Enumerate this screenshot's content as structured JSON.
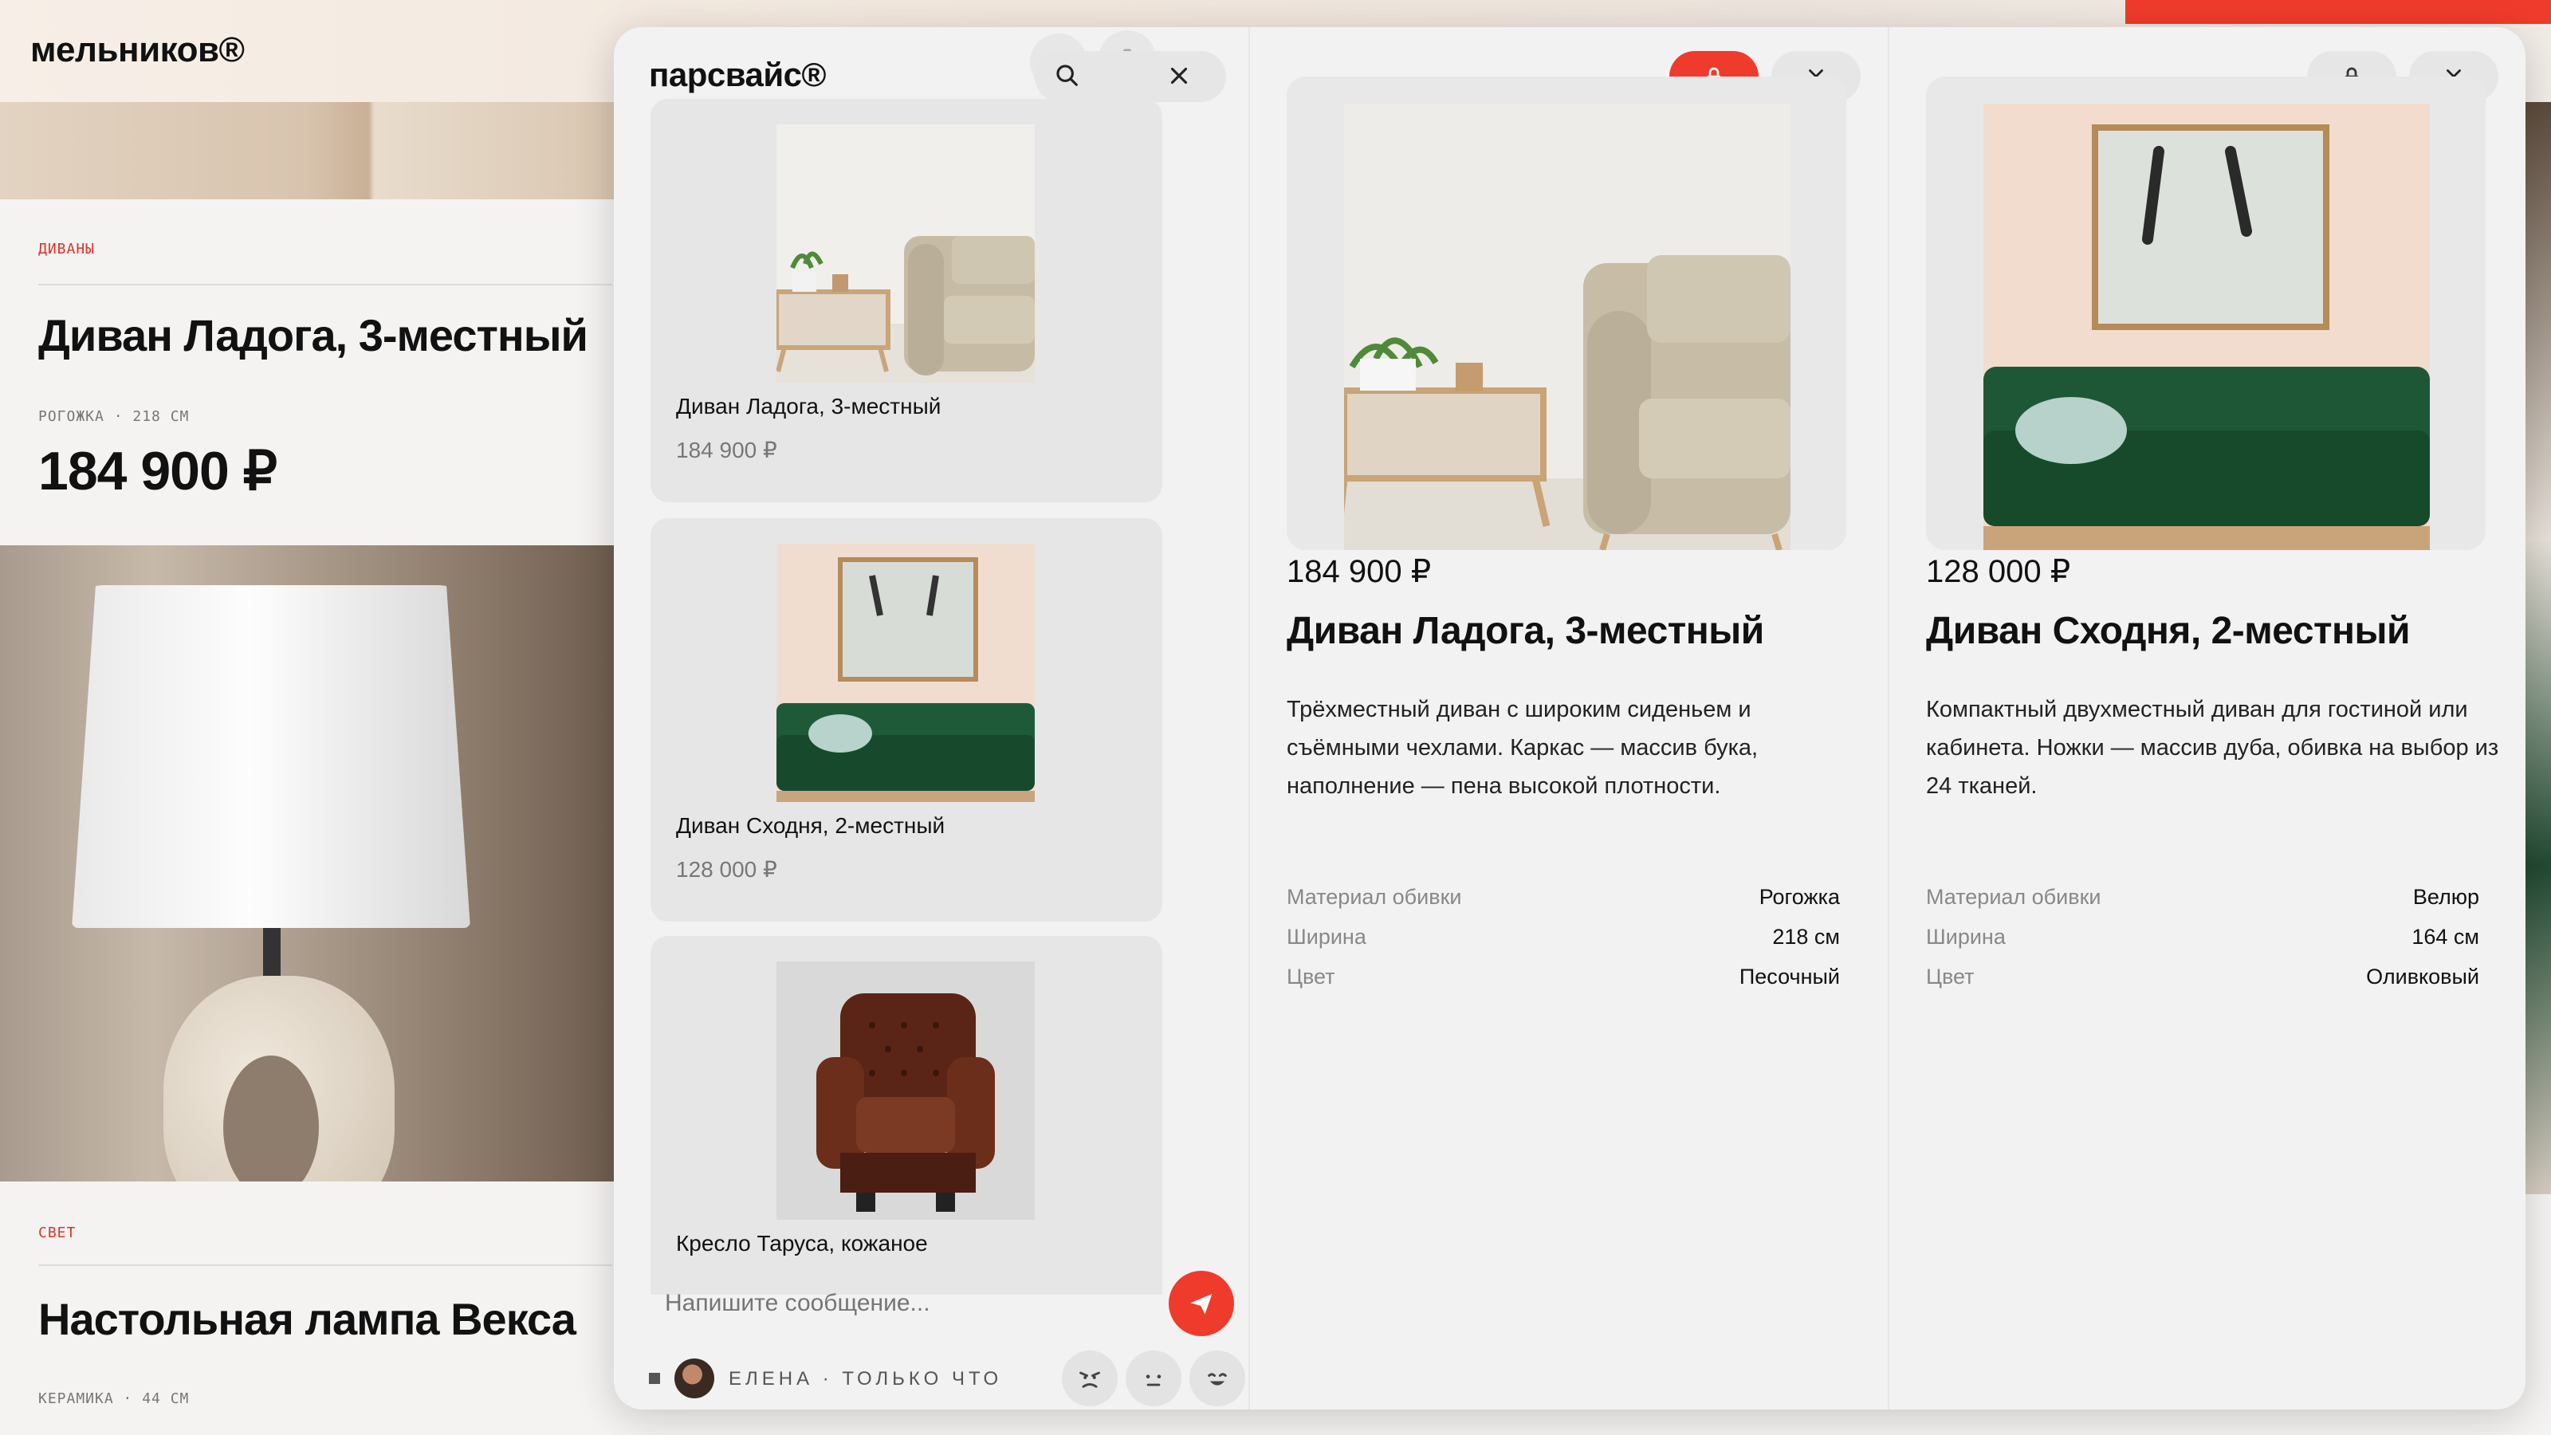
{
  "background": {
    "logo": "мельников®",
    "card1": {
      "kicker": "ДИВАНЫ",
      "title": "Диван Ладога, 3-местный",
      "meta": "РОГОЖКА · 218 СМ",
      "price": "184 900 ₽"
    },
    "card2": {
      "kicker": "СВЕТ",
      "title": "Настольная лампа Векса",
      "meta": "КЕРАМИКА · 44 СМ"
    }
  },
  "chat": {
    "brand": "парсвайс®",
    "search_icon": "search-icon",
    "close_icon": "close-icon",
    "items": [
      {
        "name": "Диван Ладога, 3-местный",
        "price": "184 900 ₽"
      },
      {
        "name": "Диван Сходня, 2-местный",
        "price": "128 000 ₽"
      },
      {
        "name": "Кресло Таруса, кожаное",
        "price": ""
      }
    ],
    "composer": {
      "placeholder": "Напишите сообщение..."
    },
    "footer": {
      "author": "ЕЛЕНА · ТОЛЬКО ЧТО"
    }
  },
  "products": [
    {
      "price": "184 900 ₽",
      "title": "Диван Ладога, 3-местный",
      "description": "Трёхместный диван с широким сиденьем и съёмными чехлами. Каркас — массив бука, наполнение — пена высокой плотности.",
      "locked": true,
      "specs": [
        {
          "k": "Материал обивки",
          "v": "Рогожка"
        },
        {
          "k": "Ширина",
          "v": "218 см"
        },
        {
          "k": "Цвет",
          "v": "Песочный"
        }
      ]
    },
    {
      "price": "128 000 ₽",
      "title": "Диван Сходня, 2-местный",
      "description": "Компактный двухместный диван для гостиной или кабинета. Ножки — массив дуба, обивка на выбор из 24 тканей.",
      "locked": false,
      "specs": [
        {
          "k": "Материал обивки",
          "v": "Велюр"
        },
        {
          "k": "Ширина",
          "v": "164 см"
        },
        {
          "k": "Цвет",
          "v": "Оливковый"
        }
      ]
    }
  ],
  "colors": {
    "accent": "#ef3b2c",
    "panel": "#f2f2f2",
    "card": "#e6e6e6"
  }
}
